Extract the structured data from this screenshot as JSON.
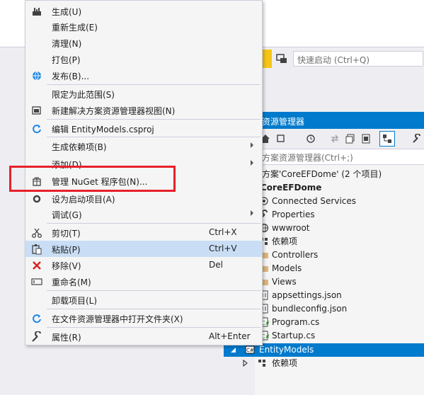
{
  "quick_launch": {
    "placeholder": "快速启动 (Ctrl+Q)"
  },
  "solution_explorer": {
    "title": "资源管理器",
    "search_placeholder": "方案资源管理器(Ctrl+;)",
    "items": [
      {
        "label": "方案'CoreEFDome' (2 个项目)"
      },
      {
        "label": "CoreEFDome"
      },
      {
        "label": "Connected Services"
      },
      {
        "label": "Properties"
      },
      {
        "label": "wwwroot"
      },
      {
        "label": "依赖项"
      },
      {
        "label": "Controllers"
      },
      {
        "label": "Models"
      },
      {
        "label": "Views"
      },
      {
        "label": "appsettings.json"
      },
      {
        "label": "bundleconfig.json"
      },
      {
        "label": "Program.cs"
      },
      {
        "label": "Startup.cs"
      },
      {
        "label": "EntityModels"
      },
      {
        "label": "依赖项"
      }
    ]
  },
  "menu": {
    "items": [
      {
        "label": "生成(U)",
        "shortcut": "",
        "icon": "build-icon"
      },
      {
        "label": "重新生成(E)",
        "shortcut": ""
      },
      {
        "label": "清理(N)",
        "shortcut": ""
      },
      {
        "label": "打包(P)",
        "shortcut": ""
      },
      {
        "label": "发布(B)...",
        "shortcut": "",
        "icon": "globe-icon"
      },
      {
        "label": "限定为此范围(S)",
        "shortcut": ""
      },
      {
        "label": "新建解决方案资源管理器视图(N)",
        "shortcut": "",
        "icon": "new-view-icon"
      },
      {
        "label": "编辑 EntityModels.csproj",
        "shortcut": "",
        "icon": "refresh-icon"
      },
      {
        "label": "生成依赖项(B)",
        "shortcut": "",
        "submenu": true
      },
      {
        "label": "添加(D)",
        "shortcut": "",
        "submenu": true
      },
      {
        "label": "管理 NuGet 程序包(N)...",
        "shortcut": "",
        "icon": "nuget-icon"
      },
      {
        "label": "设为启动项目(A)",
        "shortcut": "",
        "icon": "gear-icon"
      },
      {
        "label": "调试(G)",
        "shortcut": "",
        "submenu": true
      },
      {
        "label": "剪切(T)",
        "shortcut": "Ctrl+X",
        "icon": "scissors-icon"
      },
      {
        "label": "粘贴(P)",
        "shortcut": "Ctrl+V",
        "icon": "paste-icon"
      },
      {
        "label": "移除(V)",
        "shortcut": "Del",
        "icon": "x-icon"
      },
      {
        "label": "重命名(M)",
        "shortcut": "",
        "icon": "rename-icon"
      },
      {
        "label": "卸载项目(L)",
        "shortcut": ""
      },
      {
        "label": "在文件资源管理器中打开文件夹(X)",
        "shortcut": "",
        "icon": "open-folder-icon"
      },
      {
        "label": "属性(R)",
        "shortcut": "Alt+Enter",
        "icon": "wrench-icon"
      }
    ]
  },
  "colors": {
    "accent": "#007acc",
    "highlight": "#c9def5",
    "annotation_red": "#e8202a"
  }
}
